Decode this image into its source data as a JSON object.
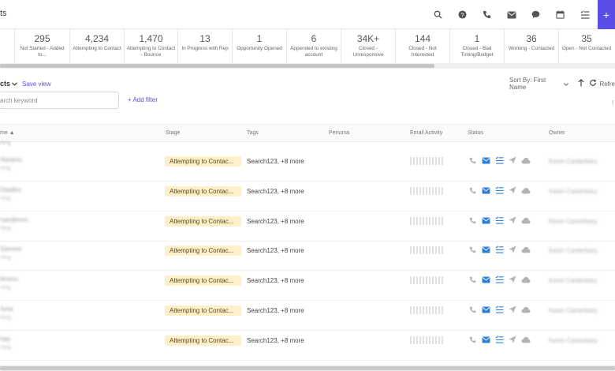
{
  "header": {
    "title": "ts",
    "icons": [
      "search-icon",
      "help-icon",
      "phone-icon",
      "mail-icon",
      "chat-icon",
      "calendar-icon",
      "tasks-icon"
    ],
    "plus_label": "+"
  },
  "stats": [
    {
      "num": "295",
      "label": "Not Started - Added to..."
    },
    {
      "num": "4,234",
      "label": "Attempting to Contact"
    },
    {
      "num": "1,470",
      "label": "Attempting to Contact - Bounce"
    },
    {
      "num": "13",
      "label": "In Progress with Rep"
    },
    {
      "num": "1",
      "label": "Opportunity Opened"
    },
    {
      "num": "6",
      "label": "Appended to existing account"
    },
    {
      "num": "34K+",
      "label": "Closed - Unresponsive"
    },
    {
      "num": "144",
      "label": "Closed - Not Interested"
    },
    {
      "num": "1",
      "label": "Closed - Bad Timing/Budget"
    },
    {
      "num": "36",
      "label": "Working - Contacted"
    },
    {
      "num": "35",
      "label": "Open - Not Contacted"
    }
  ],
  "view": {
    "name": "cts",
    "save_label": "Save view"
  },
  "sort": {
    "label": "Sort By: First Name",
    "refresh_label": "Refre"
  },
  "search": {
    "placeholder": "arch keyword"
  },
  "filter": {
    "add_label": "+ Add filter"
  },
  "right_mark": "!",
  "columns": {
    "name": "me ▲",
    "stage": "Stage",
    "tags": "Tags",
    "persona": "Persona",
    "email": "Email Activity",
    "status": "Status",
    "owner": "Owner"
  },
  "subheader": "rting",
  "rows": [
    {
      "name": "Abrams",
      "sub": "rting",
      "stage": "Attempting to Contac...",
      "tags": "Search123, +8 more",
      "owner": "Kevin Canterbery"
    },
    {
      "name": "Diadiko",
      "sub": "rting",
      "stage": "Attempting to Contac...",
      "tags": "Search123, +8 more",
      "owner": "Kevin Canterbery"
    },
    {
      "name": "Isardenon",
      "sub": "rting",
      "stage": "Attempting to Contac...",
      "tags": "Search123, +8 more",
      "owner": "Kevin Canterbery"
    },
    {
      "name": "Samme",
      "sub": "rting",
      "stage": "Attempting to Contac...",
      "tags": "Search123, +8 more",
      "owner": "Kevin Canterbery"
    },
    {
      "name": "Ilmenc",
      "sub": "rting",
      "stage": "Attempting to Contac...",
      "tags": "Search123, +8 more",
      "owner": "Kevin Canterbery"
    },
    {
      "name": "Ame",
      "sub": "rting",
      "stage": "Attempting to Contac...",
      "tags": "Search123, +8 more",
      "owner": "Kevin Canterbery"
    },
    {
      "name": "hep",
      "sub": "rting",
      "stage": "Attempting to Contac...",
      "tags": "Search123, +8 more",
      "owner": "Kevin Canterbery"
    }
  ],
  "row_status_icons": [
    "phone-icon",
    "mail-icon",
    "tasks-icon",
    "send-icon",
    "cloud-icon"
  ],
  "colors": {
    "accent": "#5b4ee6",
    "stage_bg": "#fdf0c9",
    "status_blue": "#2f7fd6",
    "status_gray": "#b3b3b3"
  }
}
